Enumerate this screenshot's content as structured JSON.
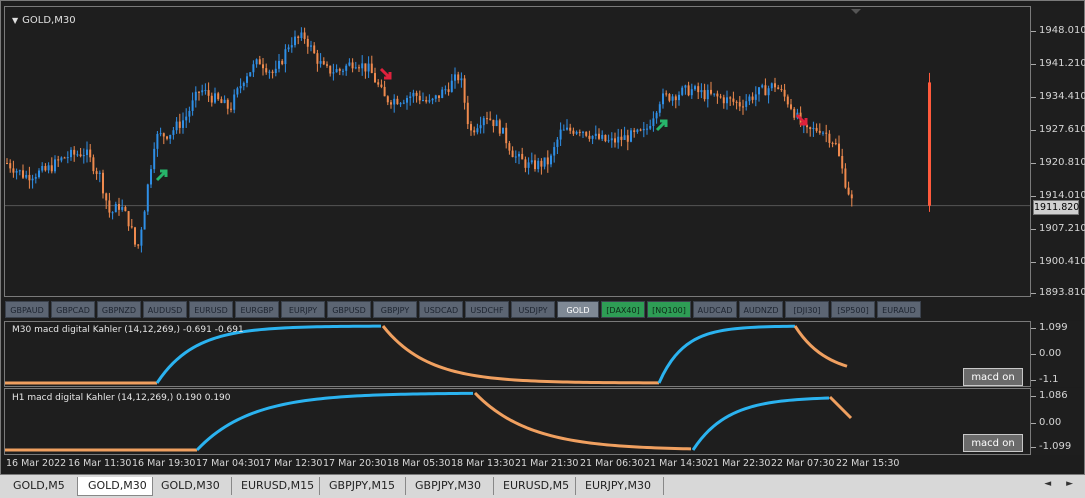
{
  "chart": {
    "title": "GOLD,M30",
    "current_price": "1911.820",
    "price_scale": [
      "1948.010",
      "1941.210",
      "1934.410",
      "1927.610",
      "1920.810",
      "1914.010",
      "1907.210",
      "1900.410",
      "1893.810"
    ],
    "up_color": "#2f8fe6",
    "down_color": "#ef8a4e",
    "arrow_down_color": "#e0213c",
    "arrow_up_color": "#27b56a"
  },
  "symbols": [
    "GBPAUD",
    "GBPCAD",
    "GBPNZD",
    "AUDUSD",
    "EURUSD",
    "EURGBP",
    "EURJPY",
    "GBPUSD",
    "GBPJPY",
    "USDCAD",
    "USDCHF",
    "USDJPY",
    "GOLD",
    "[DAX40]",
    "[NQ100]",
    "AUDCAD",
    "AUDNZD",
    "[DJI30]",
    "[SP500]",
    "EURAUD"
  ],
  "symbol_active": "GOLD",
  "symbol_green": [
    "[DAX40]",
    "[NQ100]"
  ],
  "indicator1": {
    "title": "M30   macd digital Kahler (14,12,269,) -0.691 -0.691",
    "scale": [
      "1.099",
      "0.00",
      "-1.1"
    ],
    "button": "macd on",
    "up_color": "#2bb3f0",
    "down_color": "#f0a060"
  },
  "indicator2": {
    "title": "H1   macd digital Kahler (14,12,269,) 0.190 0.190",
    "scale": [
      "1.086",
      "0.00",
      "-1.099"
    ],
    "button": "macd on"
  },
  "time_axis": [
    "16 Mar 2022",
    "16 Mar 11:30",
    "16 Mar 19:30",
    "17 Mar 04:30",
    "17 Mar 12:30",
    "17 Mar 20:30",
    "18 Mar 05:30",
    "18 Mar 13:30",
    "21 Mar 21:30",
    "21 Mar 06:30",
    "21 Mar 14:30",
    "21 Mar 22:30",
    "22 Mar 07:30",
    "22 Mar 15:30"
  ],
  "tabs": [
    "GOLD,M5",
    "GOLD,M30",
    "GOLD,M30",
    "EURUSD,M15",
    "GBPJPY,M15",
    "GBPJPY,M30",
    "EURUSD,M5",
    "EURJPY,M30"
  ],
  "active_tab": 1,
  "tab_arrows": "◄ ►"
}
